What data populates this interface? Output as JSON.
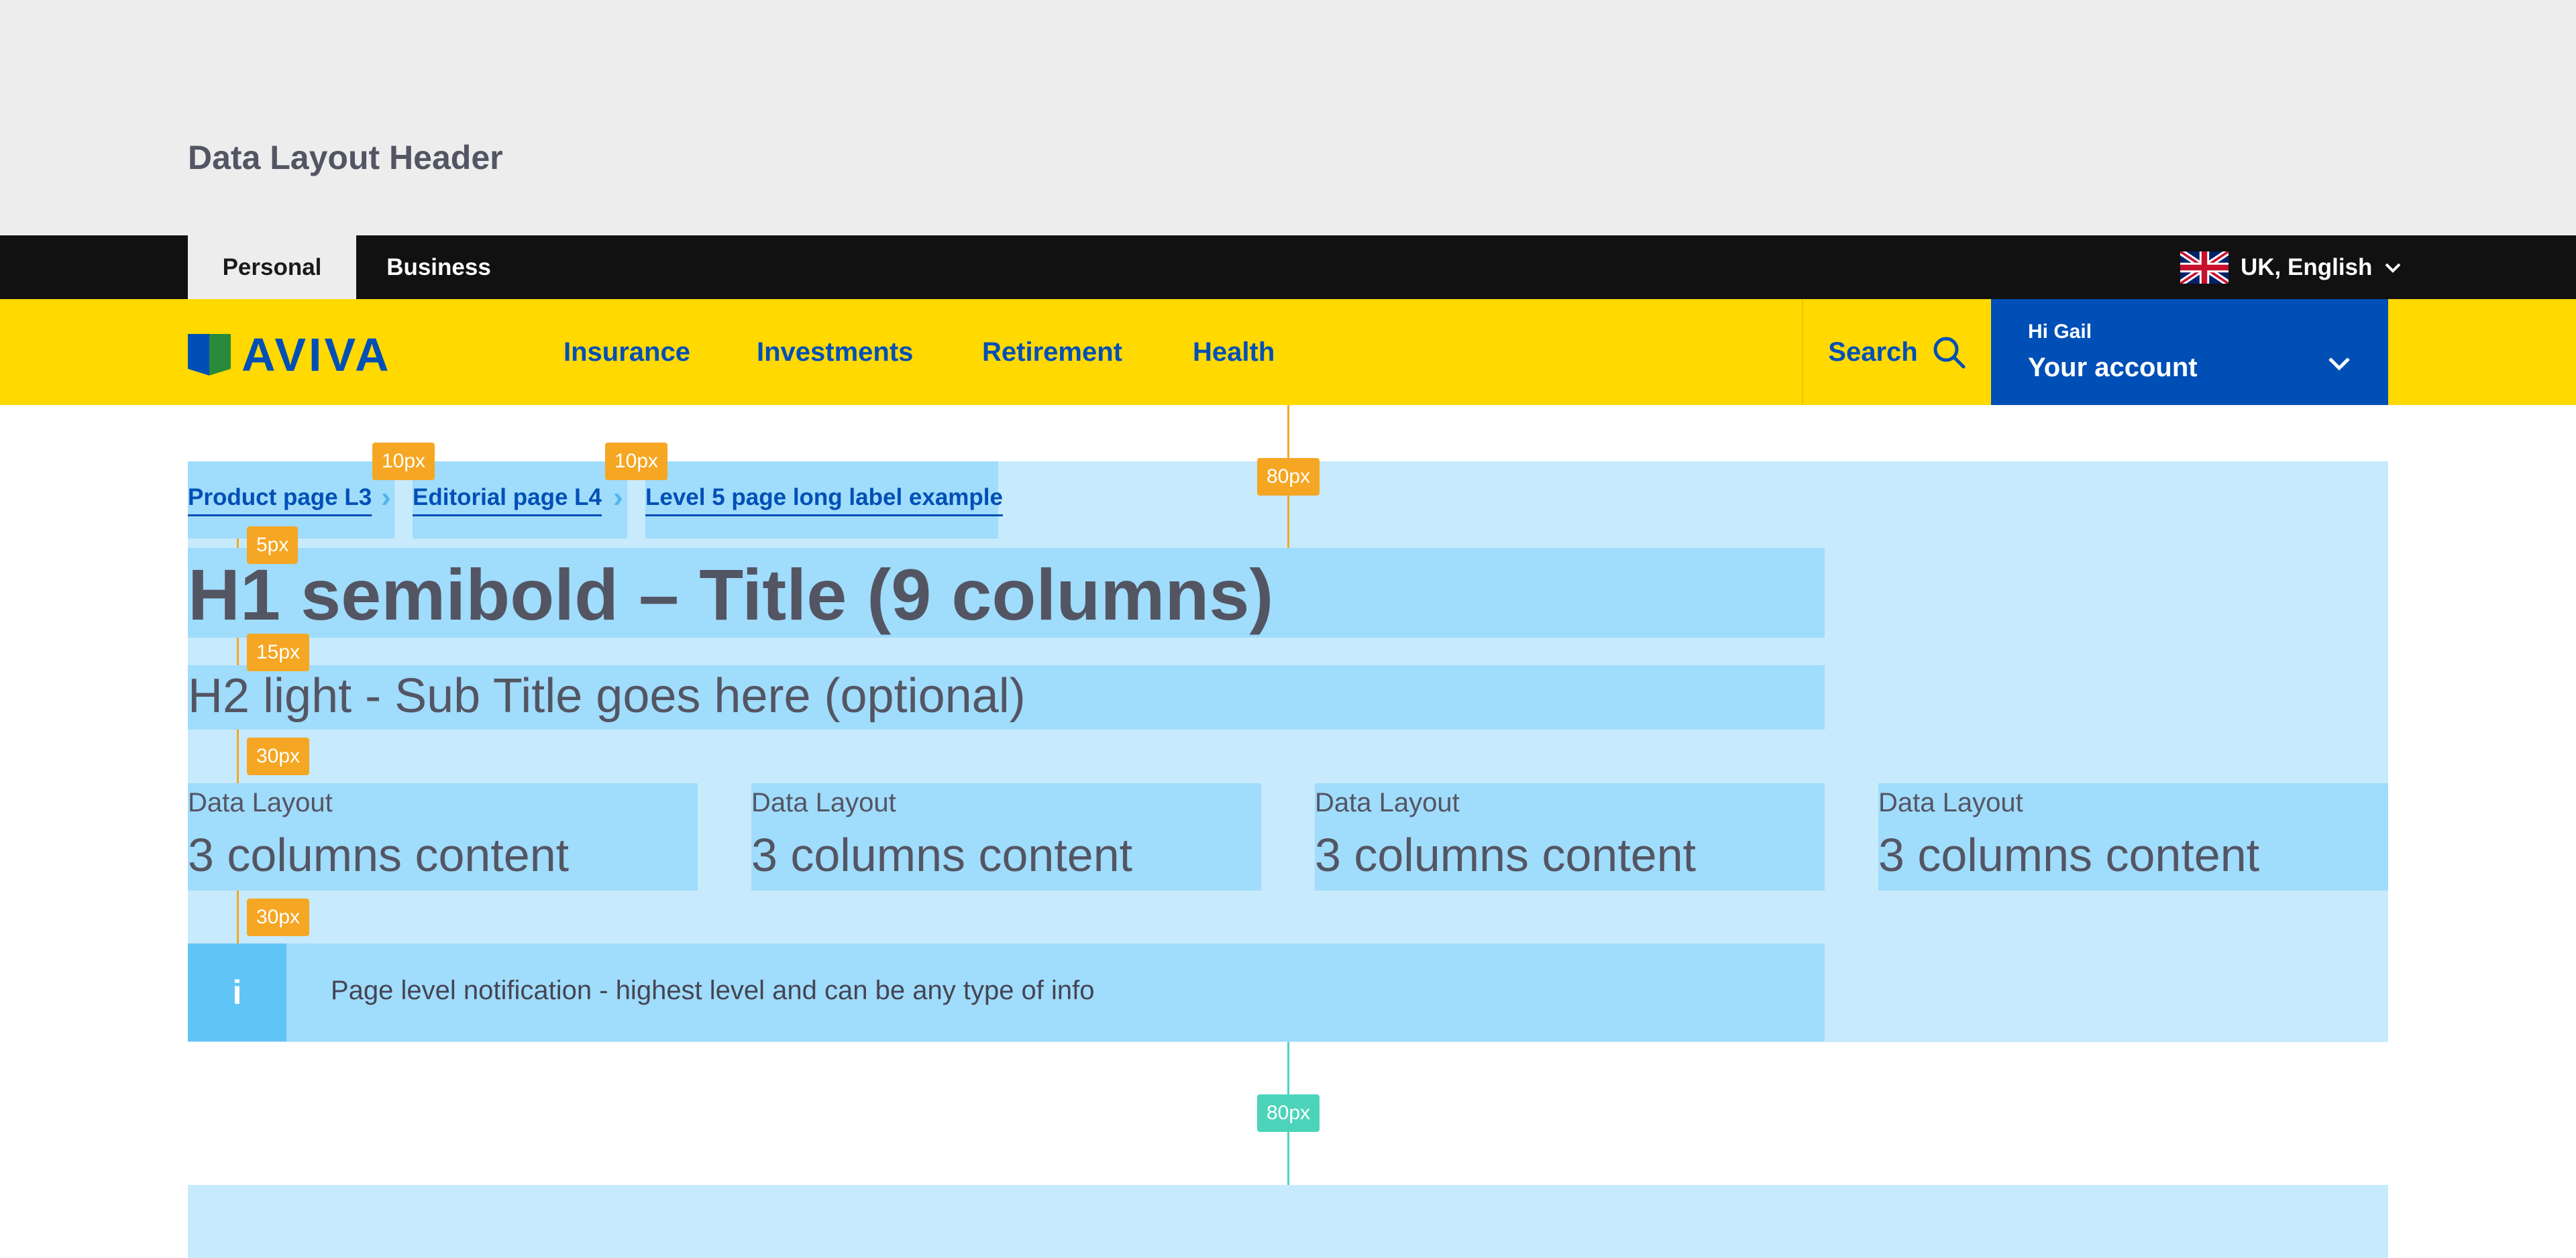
{
  "page": {
    "heading": "Data Layout Header"
  },
  "utility": {
    "tabs": [
      {
        "label": "Personal",
        "active": true
      },
      {
        "label": "Business",
        "active": false
      }
    ],
    "locale": "UK, English"
  },
  "nav": {
    "brand": "AVIVA",
    "links": [
      "Insurance",
      "Investments",
      "Retirement",
      "Health"
    ],
    "search_label": "Search",
    "account": {
      "greeting": "Hi Gail",
      "label": "Your account"
    }
  },
  "annotations": {
    "crumb_gap_1": "10px",
    "crumb_gap_2": "10px",
    "top_space": "80px",
    "crumb_to_h1": "5px",
    "h1_to_h2": "15px",
    "h2_to_columns": "30px",
    "columns_to_notice": "30px",
    "bottom_space": "80px"
  },
  "breadcrumb": [
    "Product page L3",
    "Editorial page L4",
    "Level 5 page long label example"
  ],
  "title": "H1 semibold – Title (9 columns)",
  "subtitle": "H2 light - Sub Title goes here (optional)",
  "columns": [
    {
      "label": "Data Layout",
      "content": "3 columns content"
    },
    {
      "label": "Data Layout",
      "content": "3 columns content"
    },
    {
      "label": "Data Layout",
      "content": "3 columns content"
    },
    {
      "label": "Data Layout",
      "content": "3 columns content"
    }
  ],
  "notification": {
    "icon": "i",
    "text": "Page level notification - highest level and can be any type of info"
  },
  "colors": {
    "brand_yellow": "#ffd900",
    "brand_blue": "#004fb6",
    "annotation_orange": "#f5a623",
    "annotation_green": "#4cd4bb"
  }
}
